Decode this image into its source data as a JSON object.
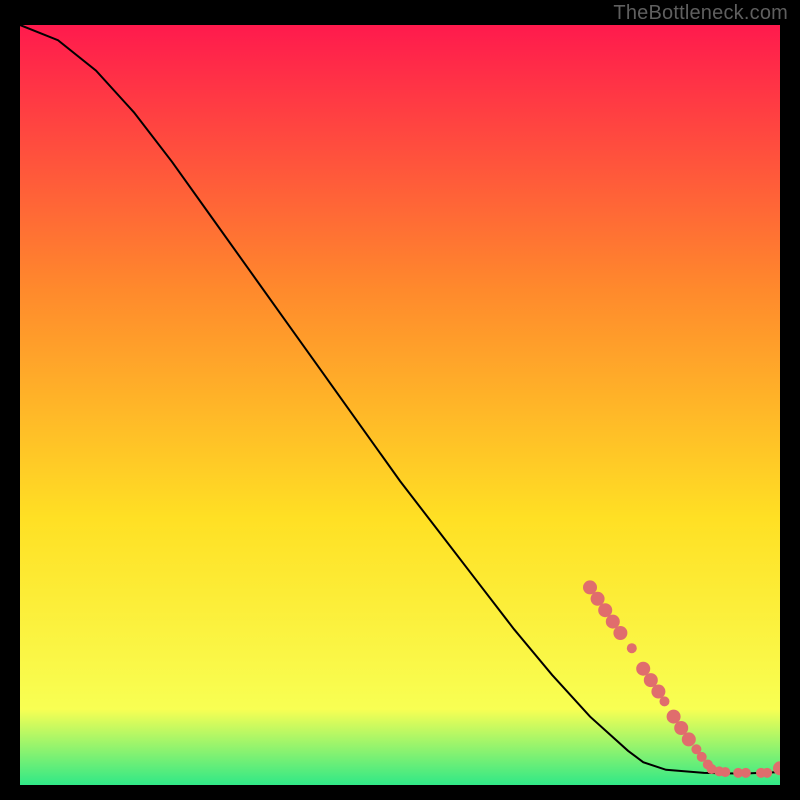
{
  "attribution": "TheBottleneck.com",
  "chart_data": {
    "type": "line",
    "title": "",
    "xlabel": "",
    "ylabel": "",
    "xlim": [
      0,
      100
    ],
    "ylim": [
      0,
      100
    ],
    "grid": false,
    "background_gradient": {
      "top": "#ff1a4d",
      "mid_upper": "#ff8a2c",
      "mid": "#ffe024",
      "mid_lower": "#f8ff53",
      "bottom": "#30e887"
    },
    "series": [
      {
        "name": "curve",
        "color": "#000000",
        "x": [
          0,
          5,
          10,
          15,
          20,
          25,
          30,
          35,
          40,
          45,
          50,
          55,
          60,
          65,
          70,
          75,
          80,
          82,
          85,
          90,
          95,
          100
        ],
        "y": [
          100,
          98,
          94,
          88.5,
          82,
          75,
          68,
          61,
          54,
          47,
          40,
          33.5,
          27,
          20.5,
          14.5,
          9,
          4.5,
          3,
          2,
          1.6,
          1.5,
          1.7
        ]
      }
    ],
    "highlight_points": {
      "name": "highlight",
      "color": "#e06d6d",
      "radius_small": 5,
      "radius_large": 7,
      "points": [
        {
          "x": 75,
          "y": 26,
          "r": 7
        },
        {
          "x": 76,
          "y": 24.5,
          "r": 7
        },
        {
          "x": 77,
          "y": 23,
          "r": 7
        },
        {
          "x": 78,
          "y": 21.5,
          "r": 7
        },
        {
          "x": 79,
          "y": 20,
          "r": 7
        },
        {
          "x": 80.5,
          "y": 18,
          "r": 5
        },
        {
          "x": 82,
          "y": 15.3,
          "r": 7
        },
        {
          "x": 83,
          "y": 13.8,
          "r": 7
        },
        {
          "x": 84,
          "y": 12.3,
          "r": 7
        },
        {
          "x": 84.8,
          "y": 11,
          "r": 5
        },
        {
          "x": 86,
          "y": 9,
          "r": 7
        },
        {
          "x": 87,
          "y": 7.5,
          "r": 7
        },
        {
          "x": 88,
          "y": 6,
          "r": 7
        },
        {
          "x": 89,
          "y": 4.7,
          "r": 5
        },
        {
          "x": 89.7,
          "y": 3.7,
          "r": 5
        },
        {
          "x": 90.5,
          "y": 2.7,
          "r": 5
        },
        {
          "x": 91,
          "y": 2.1,
          "r": 5
        },
        {
          "x": 92,
          "y": 1.8,
          "r": 5
        },
        {
          "x": 92.8,
          "y": 1.7,
          "r": 5
        },
        {
          "x": 94.5,
          "y": 1.6,
          "r": 5
        },
        {
          "x": 95.5,
          "y": 1.6,
          "r": 5
        },
        {
          "x": 97.5,
          "y": 1.6,
          "r": 5
        },
        {
          "x": 98.3,
          "y": 1.6,
          "r": 5
        },
        {
          "x": 100,
          "y": 2.2,
          "r": 7
        }
      ]
    }
  }
}
